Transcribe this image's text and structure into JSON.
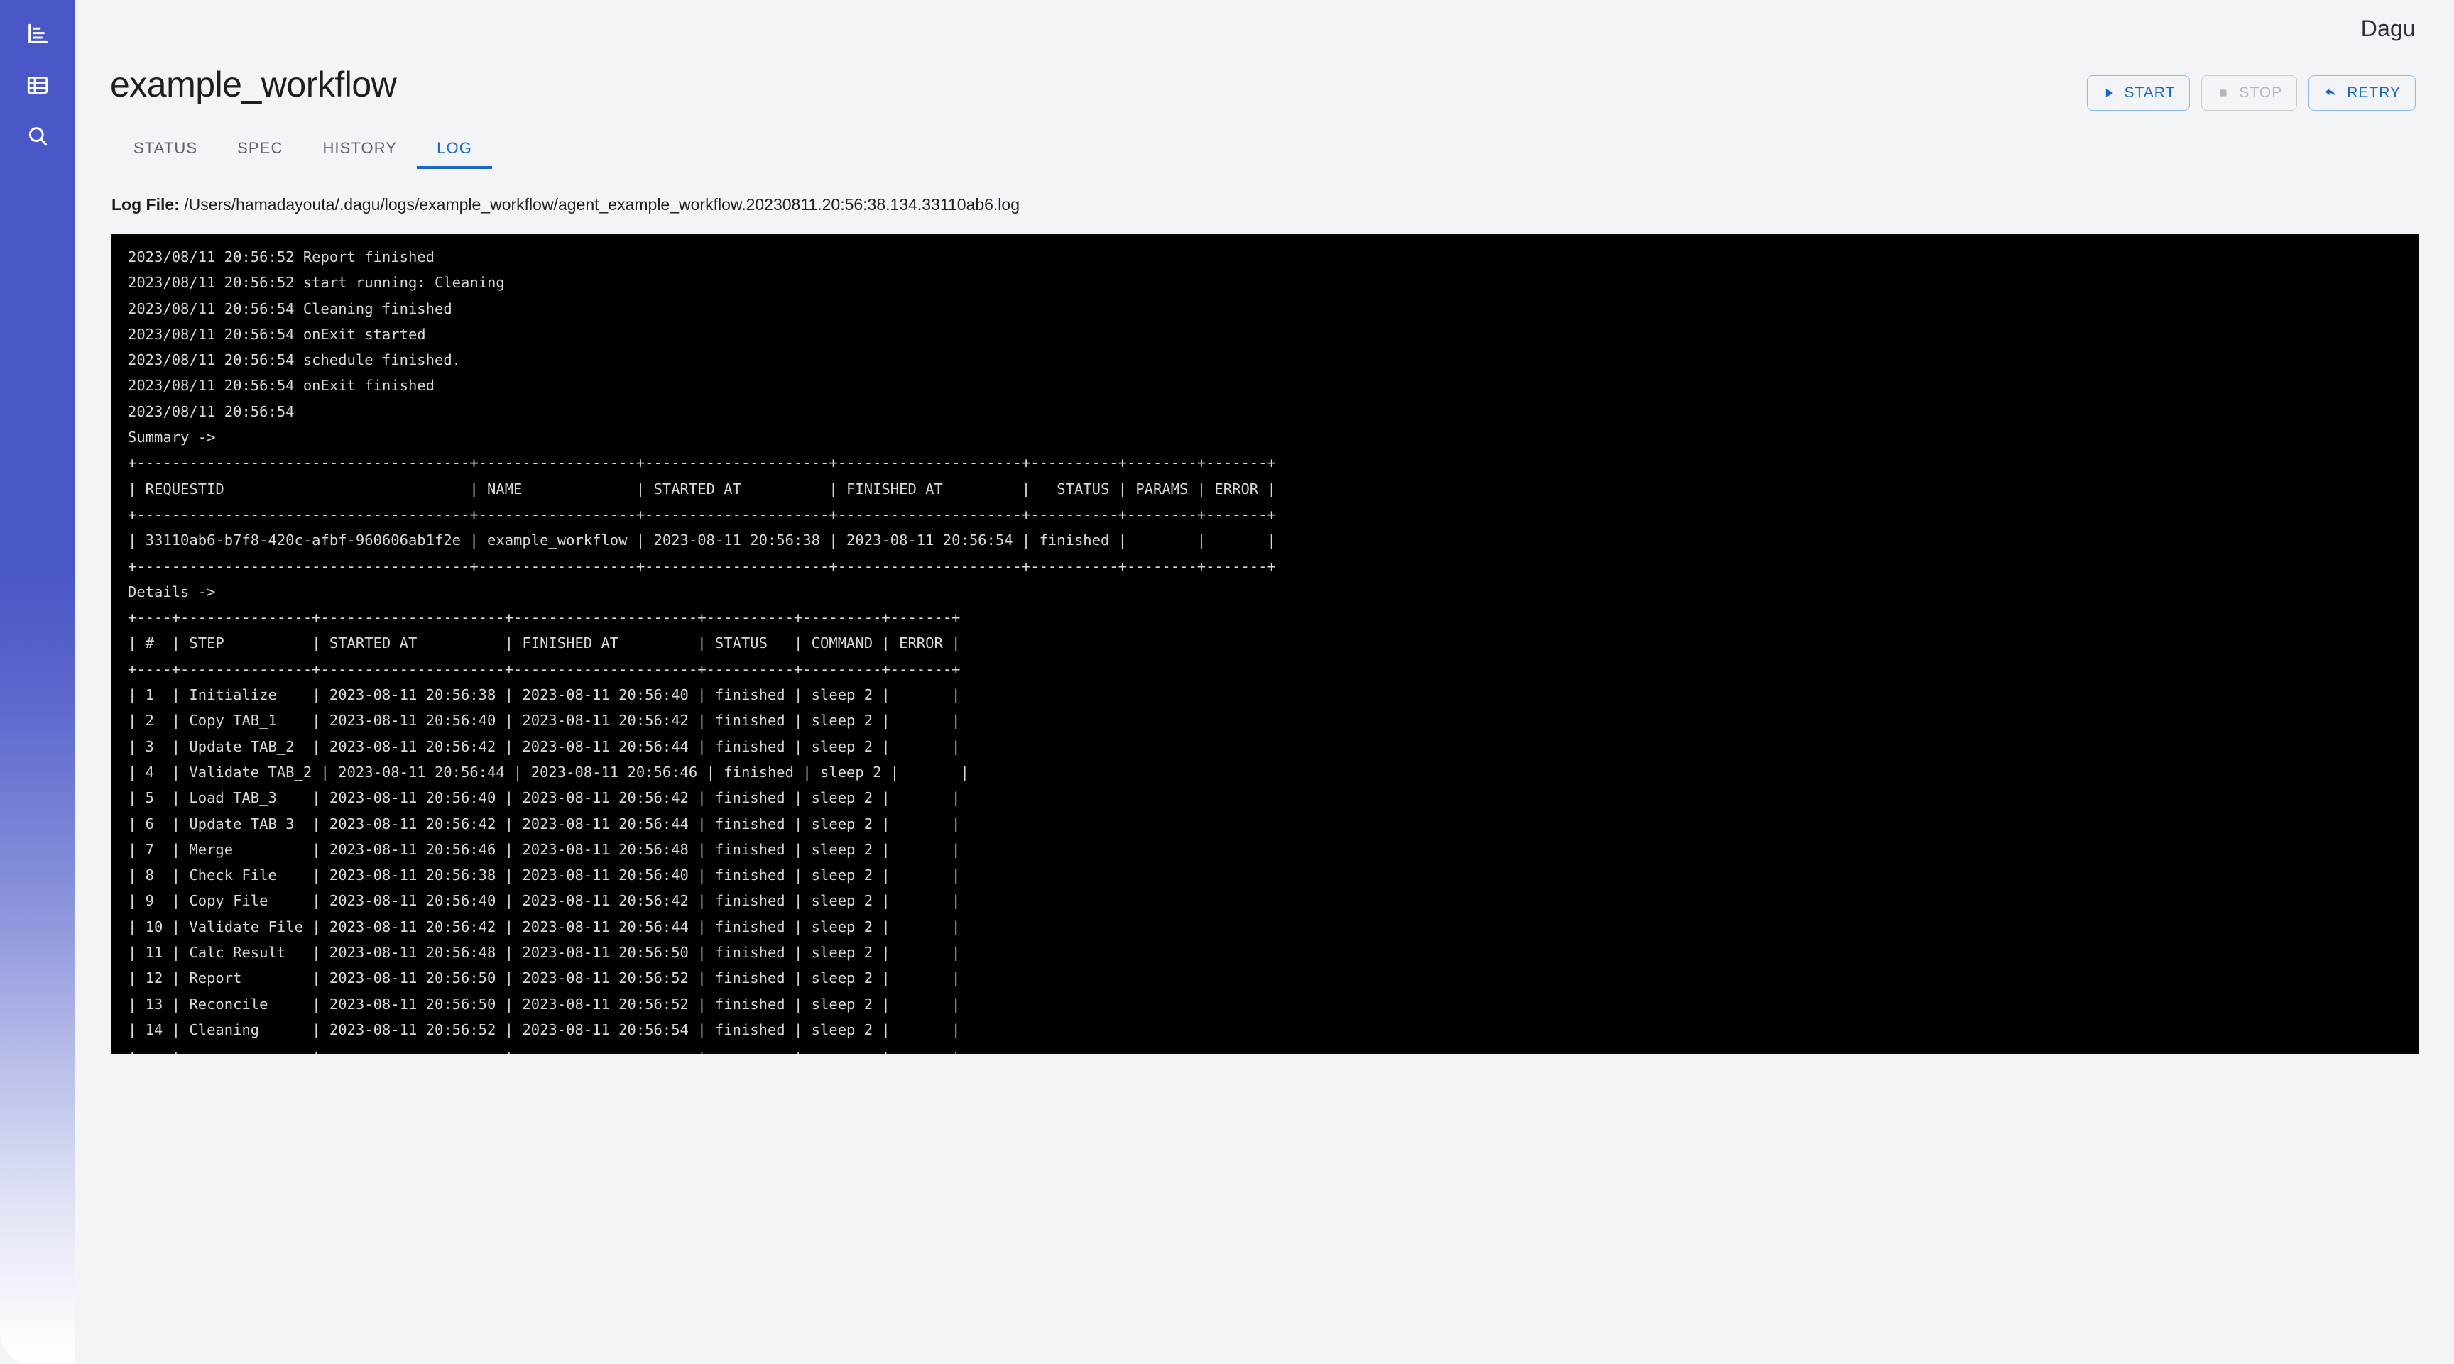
{
  "brand": {
    "title": "Dagu"
  },
  "sidebar": {
    "items": [
      {
        "name": "dashboard-icon",
        "label": "Dashboard"
      },
      {
        "name": "dags-list-icon",
        "label": "DAGs"
      },
      {
        "name": "search-icon",
        "label": "Search"
      }
    ]
  },
  "header": {
    "page_title": "example_workflow"
  },
  "actions": [
    {
      "label": "START",
      "icon": "play-icon",
      "disabled": false
    },
    {
      "label": "STOP",
      "icon": "stop-icon",
      "disabled": true
    },
    {
      "label": "RETRY",
      "icon": "retry-icon",
      "disabled": false
    }
  ],
  "tabs": [
    {
      "label": "STATUS",
      "active": false
    },
    {
      "label": "SPEC",
      "active": false
    },
    {
      "label": "HISTORY",
      "active": false
    },
    {
      "label": "LOG",
      "active": true
    }
  ],
  "logfile": {
    "label": "Log File:",
    "path": " /Users/hamadayouta/.dagu/logs/example_workflow/agent_example_workflow.20230811.20:56:38.134.33110ab6.log"
  },
  "terminal": {
    "lines": [
      "2023/08/11 20:56:52 Report finished",
      "2023/08/11 20:56:52 start running: Cleaning",
      "2023/08/11 20:56:54 Cleaning finished",
      "2023/08/11 20:56:54 onExit started",
      "2023/08/11 20:56:54 schedule finished.",
      "2023/08/11 20:56:54 onExit finished",
      "2023/08/11 20:56:54 ",
      "Summary ->",
      "+--------------------------------------+------------------+---------------------+---------------------+----------+--------+-------+",
      "| REQUESTID                            | NAME             | STARTED AT          | FINISHED AT         |   STATUS | PARAMS | ERROR |",
      "+--------------------------------------+------------------+---------------------+---------------------+----------+--------+-------+",
      "| 33110ab6-b7f8-420c-afbf-960606ab1f2e | example_workflow | 2023-08-11 20:56:38 | 2023-08-11 20:56:54 | finished |        |       |",
      "+--------------------------------------+------------------+---------------------+---------------------+----------+--------+-------+",
      "Details ->",
      "+----+---------------+---------------------+---------------------+----------+---------+-------+",
      "| #  | STEP          | STARTED AT          | FINISHED AT         | STATUS   | COMMAND | ERROR |",
      "+----+---------------+---------------------+---------------------+----------+---------+-------+",
      "| 1  | Initialize    | 2023-08-11 20:56:38 | 2023-08-11 20:56:40 | finished | sleep 2 |       |",
      "| 2  | Copy TAB_1    | 2023-08-11 20:56:40 | 2023-08-11 20:56:42 | finished | sleep 2 |       |",
      "| 3  | Update TAB_2  | 2023-08-11 20:56:42 | 2023-08-11 20:56:44 | finished | sleep 2 |       |",
      "| 4  | Validate TAB_2 | 2023-08-11 20:56:44 | 2023-08-11 20:56:46 | finished | sleep 2 |       |",
      "| 5  | Load TAB_3    | 2023-08-11 20:56:40 | 2023-08-11 20:56:42 | finished | sleep 2 |       |",
      "| 6  | Update TAB_3  | 2023-08-11 20:56:42 | 2023-08-11 20:56:44 | finished | sleep 2 |       |",
      "| 7  | Merge         | 2023-08-11 20:56:46 | 2023-08-11 20:56:48 | finished | sleep 2 |       |",
      "| 8  | Check File    | 2023-08-11 20:56:38 | 2023-08-11 20:56:40 | finished | sleep 2 |       |",
      "| 9  | Copy File     | 2023-08-11 20:56:40 | 2023-08-11 20:56:42 | finished | sleep 2 |       |",
      "| 10 | Validate File | 2023-08-11 20:56:42 | 2023-08-11 20:56:44 | finished | sleep 2 |       |",
      "| 11 | Calc Result   | 2023-08-11 20:56:48 | 2023-08-11 20:56:50 | finished | sleep 2 |       |",
      "| 12 | Report        | 2023-08-11 20:56:50 | 2023-08-11 20:56:52 | finished | sleep 2 |       |",
      "| 13 | Reconcile     | 2023-08-11 20:56:50 | 2023-08-11 20:56:52 | finished | sleep 2 |       |",
      "| 14 | Cleaning      | 2023-08-11 20:56:52 | 2023-08-11 20:56:54 | finished | sleep 2 |       |",
      "+----+---------------+---------------------+---------------------+----------+---------+-------+"
    ],
    "summary_table": {
      "columns": [
        "REQUESTID",
        "NAME",
        "STARTED AT",
        "FINISHED AT",
        "STATUS",
        "PARAMS",
        "ERROR"
      ],
      "rows": [
        [
          "33110ab6-b7f8-420c-afbf-960606ab1f2e",
          "example_workflow",
          "2023-08-11 20:56:38",
          "2023-08-11 20:56:54",
          "finished",
          "",
          ""
        ]
      ]
    },
    "details_table": {
      "columns": [
        "#",
        "STEP",
        "STARTED AT",
        "FINISHED AT",
        "STATUS",
        "COMMAND",
        "ERROR"
      ],
      "rows": [
        [
          "1",
          "Initialize",
          "2023-08-11 20:56:38",
          "2023-08-11 20:56:40",
          "finished",
          "sleep 2",
          ""
        ],
        [
          "2",
          "Copy TAB_1",
          "2023-08-11 20:56:40",
          "2023-08-11 20:56:42",
          "finished",
          "sleep 2",
          ""
        ],
        [
          "3",
          "Update TAB_2",
          "2023-08-11 20:56:42",
          "2023-08-11 20:56:44",
          "finished",
          "sleep 2",
          ""
        ],
        [
          "4",
          "Validate TAB_2",
          "2023-08-11 20:56:44",
          "2023-08-11 20:56:46",
          "finished",
          "sleep 2",
          ""
        ],
        [
          "5",
          "Load TAB_3",
          "2023-08-11 20:56:40",
          "2023-08-11 20:56:42",
          "finished",
          "sleep 2",
          ""
        ],
        [
          "6",
          "Update TAB_3",
          "2023-08-11 20:56:42",
          "2023-08-11 20:56:44",
          "finished",
          "sleep 2",
          ""
        ],
        [
          "7",
          "Merge",
          "2023-08-11 20:56:46",
          "2023-08-11 20:56:48",
          "finished",
          "sleep 2",
          ""
        ],
        [
          "8",
          "Check File",
          "2023-08-11 20:56:38",
          "2023-08-11 20:56:40",
          "finished",
          "sleep 2",
          ""
        ],
        [
          "9",
          "Copy File",
          "2023-08-11 20:56:40",
          "2023-08-11 20:56:42",
          "finished",
          "sleep 2",
          ""
        ],
        [
          "10",
          "Validate File",
          "2023-08-11 20:56:42",
          "2023-08-11 20:56:44",
          "finished",
          "sleep 2",
          ""
        ],
        [
          "11",
          "Calc Result",
          "2023-08-11 20:56:48",
          "2023-08-11 20:56:50",
          "finished",
          "sleep 2",
          ""
        ],
        [
          "12",
          "Report",
          "2023-08-11 20:56:50",
          "2023-08-11 20:56:52",
          "finished",
          "sleep 2",
          ""
        ],
        [
          "13",
          "Reconcile",
          "2023-08-11 20:56:50",
          "2023-08-11 20:56:52",
          "finished",
          "sleep 2",
          ""
        ],
        [
          "14",
          "Cleaning",
          "2023-08-11 20:56:52",
          "2023-08-11 20:56:54",
          "finished",
          "sleep 2",
          ""
        ]
      ]
    }
  },
  "colors": {
    "sidebar_top": "#4a57c6",
    "accent": "#1769c9",
    "page_bg": "#f3f4f8",
    "terminal_bg": "#000000",
    "terminal_fg": "#d9d9d9"
  }
}
